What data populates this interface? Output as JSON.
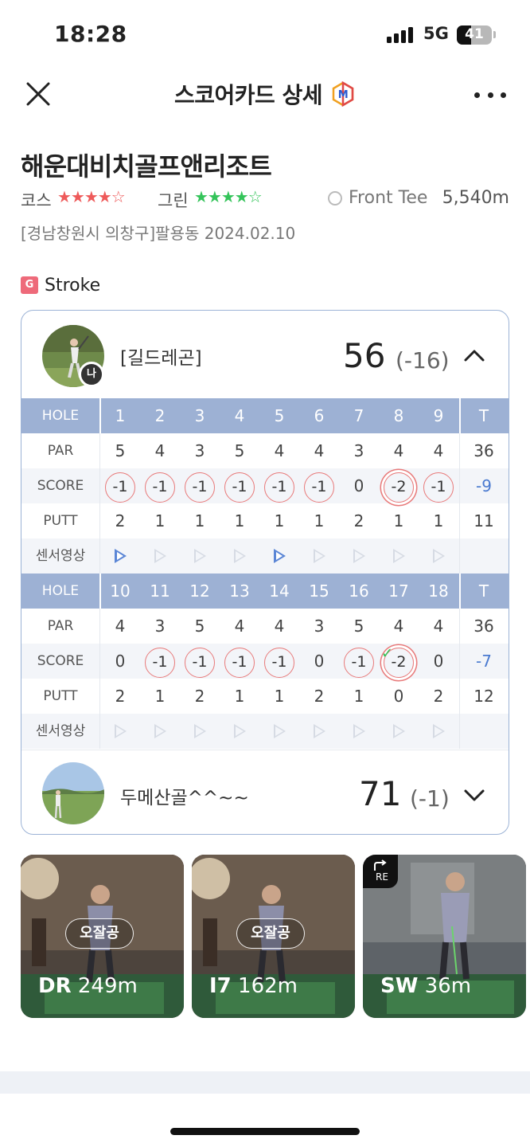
{
  "status": {
    "time": "18:28",
    "network": "5G",
    "battery": "41",
    "battery_level": 0.41
  },
  "header": {
    "title": "스코어카드 상세",
    "badge_letter": "M"
  },
  "course": {
    "name": "해운대비치골프앤리조트",
    "course_label": "코스",
    "course_stars": "★★★★☆",
    "green_label": "그린",
    "green_stars": "★★★★☆",
    "tee": "Front Tee",
    "distance": "5,540m",
    "location": "[경남창원시 의창구]팔용동 2024.02.10"
  },
  "mode": {
    "icon_letter": "G",
    "label": "Stroke"
  },
  "player1": {
    "name": "[길드레곤]",
    "me_badge": "나",
    "total": "56",
    "diff": "(-16)",
    "expanded": true
  },
  "front": {
    "hole_label": "HOLE",
    "par_label": "PAR",
    "score_label": "SCORE",
    "putt_label": "PUTT",
    "video_label": "센서영상",
    "total_label": "T",
    "holes": [
      "1",
      "2",
      "3",
      "4",
      "5",
      "6",
      "7",
      "8",
      "9"
    ],
    "par": [
      "5",
      "4",
      "3",
      "5",
      "4",
      "4",
      "3",
      "4",
      "4"
    ],
    "par_total": "36",
    "score": [
      "-1",
      "-1",
      "-1",
      "-1",
      "-1",
      "-1",
      "0",
      "-2",
      "-1"
    ],
    "score_total": "-9",
    "putt": [
      "2",
      "1",
      "1",
      "1",
      "1",
      "1",
      "2",
      "1",
      "1"
    ],
    "putt_total": "11",
    "video": [
      true,
      false,
      false,
      false,
      true,
      false,
      false,
      false,
      false
    ]
  },
  "back": {
    "hole_label": "HOLE",
    "par_label": "PAR",
    "score_label": "SCORE",
    "putt_label": "PUTT",
    "video_label": "센서영상",
    "total_label": "T",
    "holes": [
      "10",
      "11",
      "12",
      "13",
      "14",
      "15",
      "16",
      "17",
      "18"
    ],
    "par": [
      "4",
      "3",
      "5",
      "4",
      "4",
      "3",
      "5",
      "4",
      "4"
    ],
    "par_total": "36",
    "score": [
      "0",
      "-1",
      "-1",
      "-1",
      "-1",
      "0",
      "-1",
      "-2",
      "0"
    ],
    "score_total": "-7",
    "putt": [
      "2",
      "1",
      "2",
      "1",
      "1",
      "2",
      "1",
      "0",
      "2"
    ],
    "putt_total": "12",
    "video": [
      false,
      false,
      false,
      false,
      false,
      false,
      false,
      false,
      false
    ],
    "checks": [
      true,
      false,
      false,
      false,
      false,
      false,
      false,
      true,
      false
    ]
  },
  "player2": {
    "name": "두메산골^^~~",
    "total": "71",
    "diff": "(-1)",
    "expanded": false
  },
  "shots": [
    {
      "tag": "오잘공",
      "club": "DR",
      "distance": "249m",
      "replay": false
    },
    {
      "tag": "오잘공",
      "club": "I7",
      "distance": "162m",
      "replay": false
    },
    {
      "tag": "",
      "club": "SW",
      "distance": "36m",
      "replay": true,
      "replay_label": "RE"
    }
  ],
  "colors": {
    "accent_blue": "#9db1d4",
    "circle_red": "#e87a7a",
    "total_blue": "#4a7ad0",
    "star_red": "#ee5a5a",
    "star_green": "#34c45a"
  }
}
